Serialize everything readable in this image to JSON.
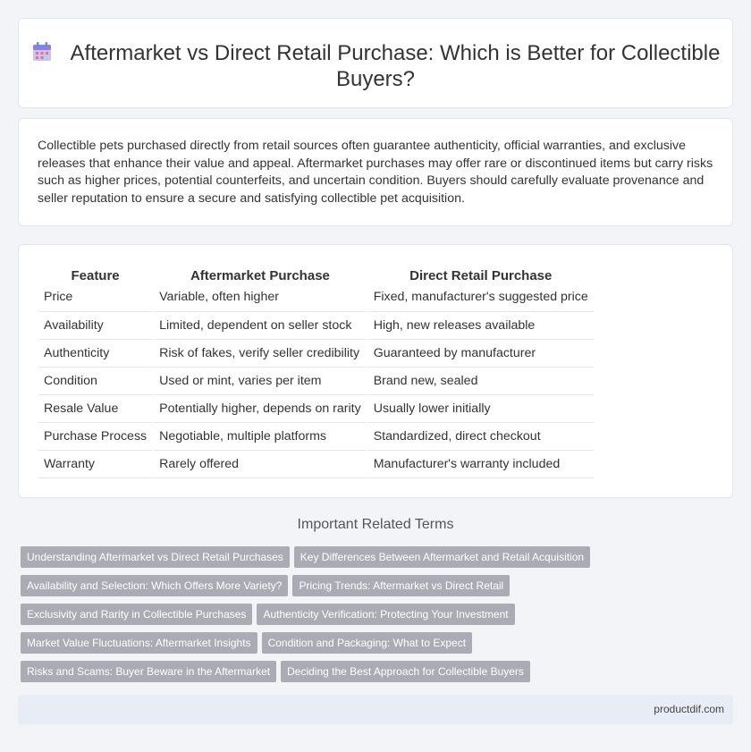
{
  "header": {
    "title": "Aftermarket vs Direct Retail Purchase: Which is Better for Collectible Buyers?",
    "icon": "calendar-icon"
  },
  "intro": {
    "text": "Collectible pets purchased directly from retail sources often guarantee authenticity, official warranties, and exclusive releases that enhance their value and appeal. Aftermarket purchases may offer rare or discontinued items but carry risks such as higher prices, potential counterfeits, and uncertain condition. Buyers should carefully evaluate provenance and seller reputation to ensure a secure and satisfying collectible pet acquisition."
  },
  "table": {
    "headers": [
      "Feature",
      "Aftermarket Purchase",
      "Direct Retail Purchase"
    ],
    "rows": [
      [
        "Price",
        "Variable, often higher",
        "Fixed, manufacturer's suggested price"
      ],
      [
        "Availability",
        "Limited, dependent on seller stock",
        "High, new releases available"
      ],
      [
        "Authenticity",
        "Risk of fakes, verify seller credibility",
        "Guaranteed by manufacturer"
      ],
      [
        "Condition",
        "Used or mint, varies per item",
        "Brand new, sealed"
      ],
      [
        "Resale Value",
        "Potentially higher, depends on rarity",
        "Usually lower initially"
      ],
      [
        "Purchase Process",
        "Negotiable, multiple platforms",
        "Standardized, direct checkout"
      ],
      [
        "Warranty",
        "Rarely offered",
        "Manufacturer's warranty included"
      ]
    ]
  },
  "related": {
    "title": "Important Related Terms",
    "tags": [
      [
        "Understanding Aftermarket vs Direct Retail Purchases",
        "Key Differences Between Aftermarket and Retail Acquisition"
      ],
      [
        "Availability and Selection: Which Offers More Variety?",
        "Pricing Trends: Aftermarket vs Direct Retail"
      ],
      [
        "Exclusivity and Rarity in Collectible Purchases",
        "Authenticity Verification: Protecting Your Investment"
      ],
      [
        "Market Value Fluctuations: Aftermarket Insights",
        "Condition and Packaging: What to Expect"
      ],
      [
        "Risks and Scams: Buyer Beware in the Aftermarket",
        "Deciding the Best Approach for Collectible Buyers"
      ]
    ]
  },
  "footer": {
    "site": "productdif.com"
  },
  "colors": {
    "background": "#f3f4f8",
    "tag": "#a9acb5",
    "footer": "#e8ecf5"
  }
}
